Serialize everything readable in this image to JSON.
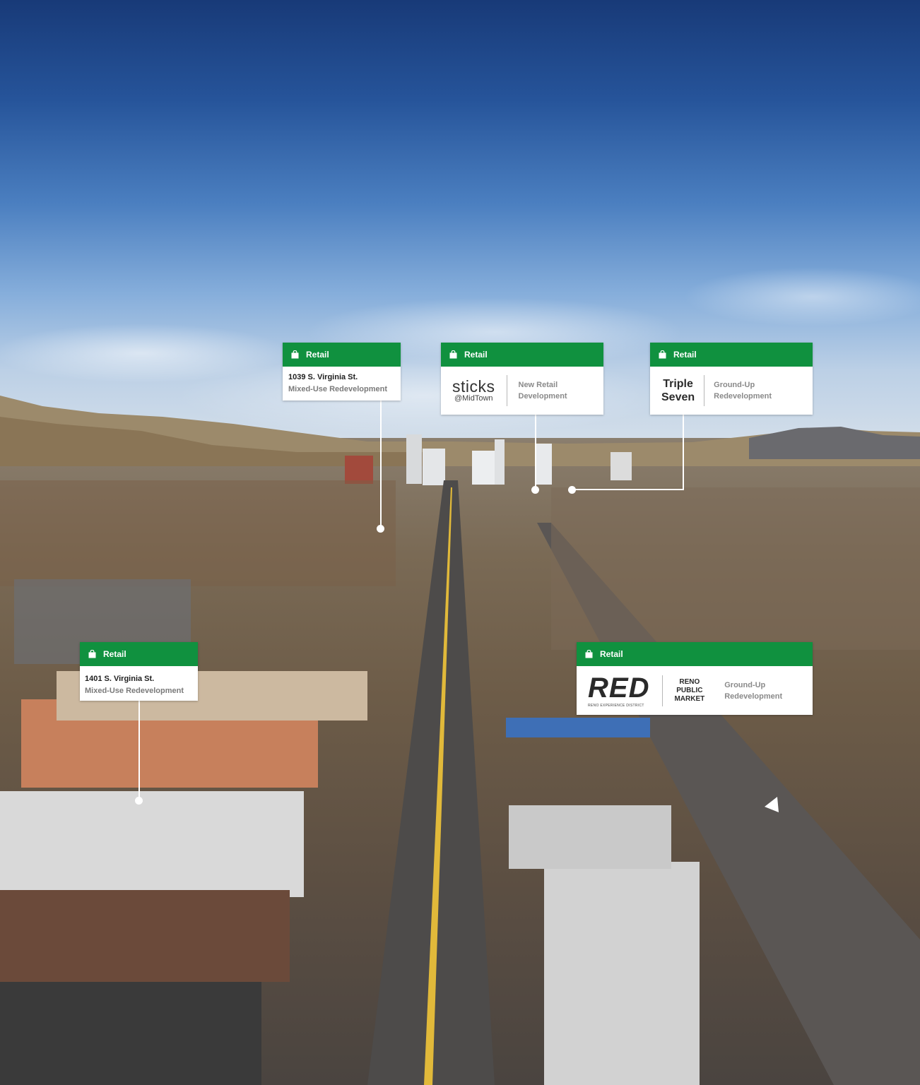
{
  "cards": [
    {
      "category": "Retail",
      "address": "1039 S. Virginia St.",
      "subtitle": "Mixed-Use Redevelopment"
    },
    {
      "category": "Retail",
      "logo_main": "sticks",
      "logo_sub": "@MidTown",
      "desc_line1": "New Retail",
      "desc_line2": "Development"
    },
    {
      "category": "Retail",
      "logo_line1": "Triple",
      "logo_line2": "Seven",
      "desc_line1": "Ground-Up",
      "desc_line2": "Redevelopment"
    },
    {
      "category": "Retail",
      "address": "1401 S. Virginia St.",
      "subtitle": "Mixed-Use Redevelopment"
    },
    {
      "category": "Retail",
      "logo_main": "RED",
      "logo_sub": "RENO EXPERIENCE DISTRICT",
      "logo2_line1": "RENO",
      "logo2_line2": "PUBLIC",
      "logo2_line3": "MARKET",
      "desc_line1": "Ground-Up",
      "desc_line2": "Redevelopment"
    }
  ],
  "colors": {
    "card_header": "#10913f",
    "leader": "#ffffff"
  }
}
